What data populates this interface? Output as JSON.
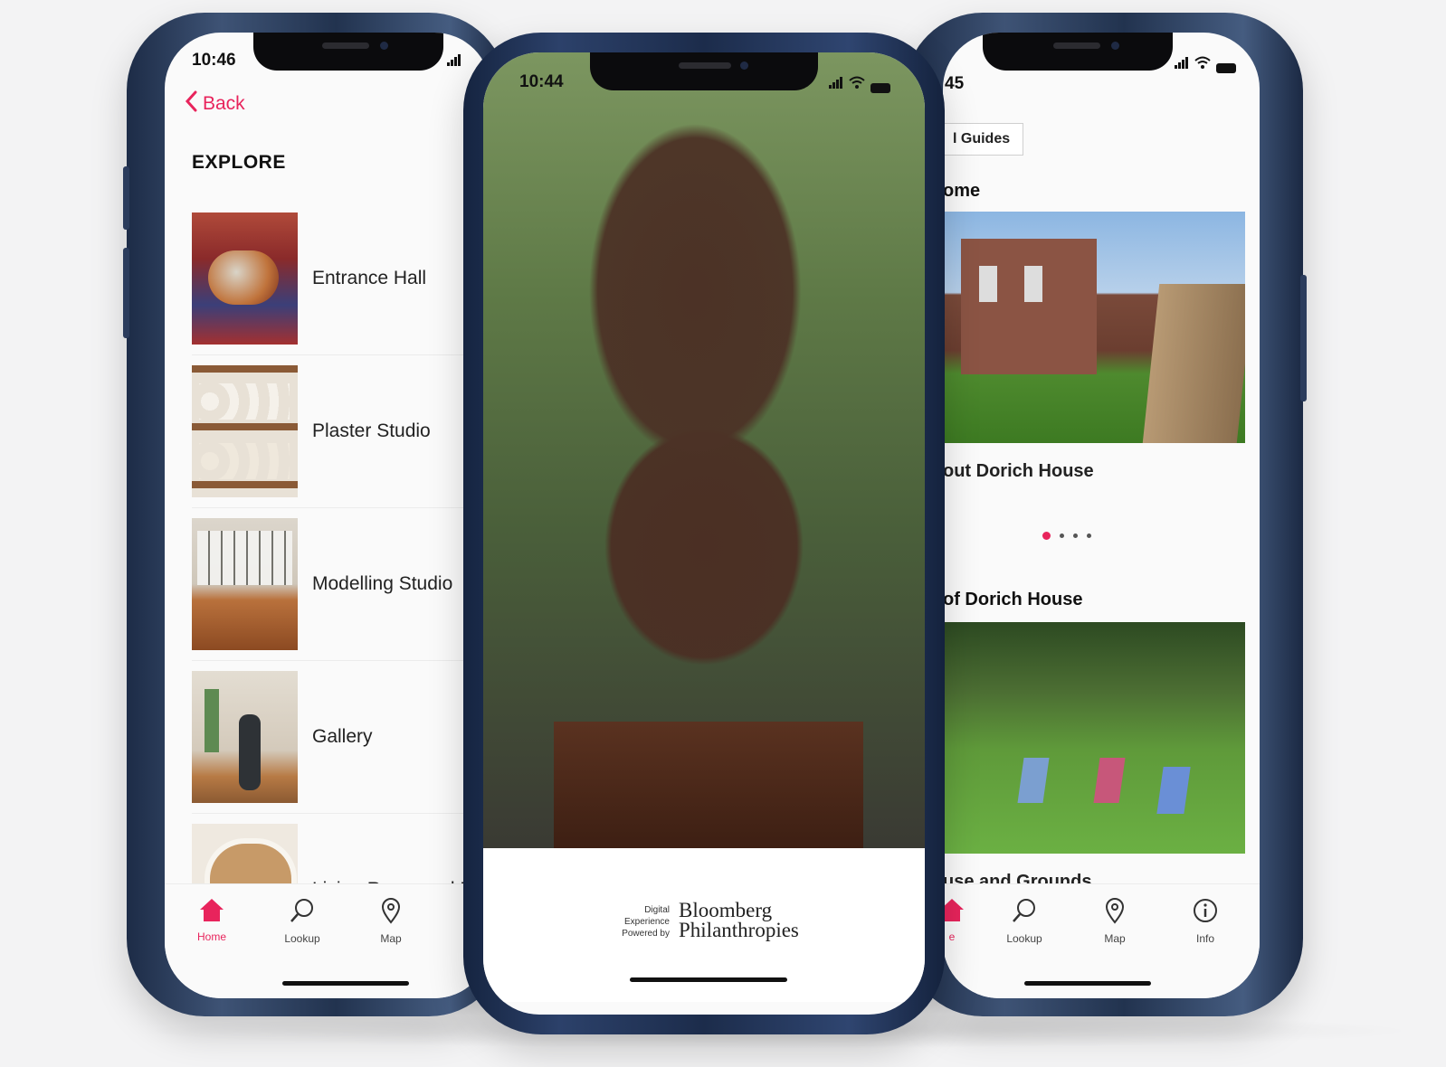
{
  "left_phone": {
    "time": "10:46",
    "back_label": "Back",
    "section_title": "EXPLORE",
    "rooms": [
      {
        "label": "Entrance Hall"
      },
      {
        "label": "Plaster Studio"
      },
      {
        "label": "Modelling Studio"
      },
      {
        "label": "Gallery"
      },
      {
        "label": "Living Room and Dinir"
      }
    ],
    "tabs": [
      {
        "label": "Home",
        "icon": "home-icon"
      },
      {
        "label": "Lookup",
        "icon": "search-icon"
      },
      {
        "label": "Map",
        "icon": "map-pin-icon"
      }
    ]
  },
  "middle_phone": {
    "time": "10:44",
    "sponsor_small": [
      "Digital",
      "Experience",
      "Powered by"
    ],
    "sponsor_brand": [
      "Bloomberg",
      "Philanthropies"
    ]
  },
  "right_phone": {
    "time": "45",
    "guides_label": "l Guides",
    "home_title": "ome",
    "card1_caption": "out Dorich House",
    "card2_title": "of Dorich House",
    "card2_caption": "use and Grounds",
    "carousel": {
      "count": 4,
      "active": 0
    },
    "tabs": [
      {
        "label": "e",
        "icon": "home-icon"
      },
      {
        "label": "Lookup",
        "icon": "search-icon"
      },
      {
        "label": "Map",
        "icon": "map-pin-icon"
      },
      {
        "label": "Info",
        "icon": "info-icon"
      }
    ]
  },
  "colors": {
    "accent": "#e8245c",
    "frame": "#2e4163",
    "background": "#f3f3f4"
  }
}
